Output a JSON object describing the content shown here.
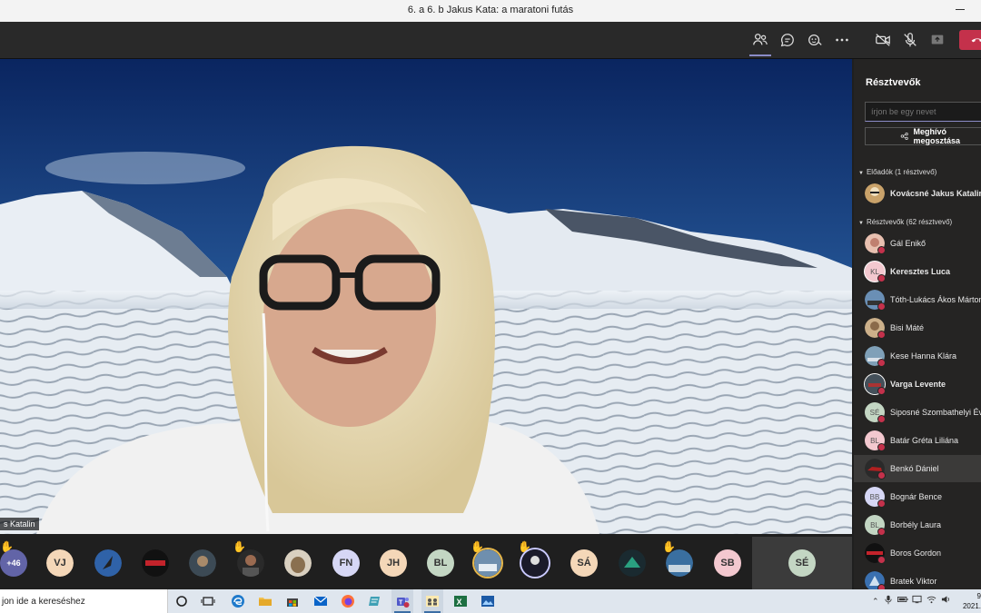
{
  "window": {
    "title": "6. a 6. b Jakus Kata: a maratoni futás"
  },
  "toolbar": {
    "icons": [
      "people-icon",
      "chat-icon",
      "reactions-icon",
      "more-icon",
      "camera-off-icon",
      "mic-off-icon",
      "share-icon",
      "hangup-icon"
    ]
  },
  "stage": {
    "speaker_label": "s Katalin"
  },
  "gallery": {
    "overflow_label": "+46",
    "tiles": [
      {
        "initials": "VJ",
        "color": "#f4d7b8"
      },
      {
        "initials": "FN",
        "color": "#d6d7f5"
      },
      {
        "initials": "JH",
        "color": "#f4d7b8"
      },
      {
        "initials": "BL",
        "color": "#c3d6c3"
      },
      {
        "initials": "SÁ",
        "color": "#f4d7b8"
      },
      {
        "initials": "SB",
        "color": "#f3c8cf"
      }
    ],
    "self_initials": "SÉ"
  },
  "panel": {
    "title": "Résztvevők",
    "search_placeholder": "írjon be egy nevet",
    "invite_label": "Meghívó megosztása",
    "presenters_header": "Előadók (1 résztvevő)",
    "attendees_header": "Résztvevők (62 résztvevő)",
    "presenter": {
      "name": "Kovácsné Jakus Katalin",
      "bold": true
    },
    "attendees": [
      {
        "name": "Gál Enikő",
        "initials": "",
        "bold": false,
        "color": "#d8a0a0"
      },
      {
        "name": "Keresztes Luca",
        "initials": "KL",
        "bold": true,
        "color": "#f3c8cf"
      },
      {
        "name": "Tóth-Lukács Ákos Márton",
        "initials": "",
        "bold": false,
        "color": "#6a8fb5"
      },
      {
        "name": "Bisi Máté",
        "initials": "",
        "bold": false,
        "color": "#8a6a4a"
      },
      {
        "name": "Kese Hanna Klára",
        "initials": "",
        "bold": false,
        "color": "#7fa0b8"
      },
      {
        "name": "Varga Levente",
        "initials": "",
        "bold": true,
        "color": "#44505a"
      },
      {
        "name": "Siposné Szombathelyi Éva",
        "initials": "SÉ",
        "bold": false,
        "color": "#c3d6c3"
      },
      {
        "name": "Batár Gréta Liliána",
        "initials": "BL",
        "bold": false,
        "color": "#f3c8cf"
      },
      {
        "name": "Benkó Dániel",
        "initials": "",
        "bold": false,
        "color": "#8a2020"
      },
      {
        "name": "Bognár Bence",
        "initials": "BB",
        "bold": false,
        "color": "#d6d7f5"
      },
      {
        "name": "Borbély Laura",
        "initials": "BL",
        "bold": false,
        "color": "#c3d6c3"
      },
      {
        "name": "Boros Gordon",
        "initials": "",
        "bold": false,
        "color": "#111111"
      },
      {
        "name": "Bratek Viktor",
        "initials": "",
        "bold": false,
        "color": "#3a70b0"
      }
    ]
  },
  "taskbar": {
    "search_text": "jon ide a kereséshez",
    "clock_time": "9",
    "clock_date": "2021."
  },
  "colors": {
    "accent": "#8b8cc7",
    "hangup": "#c4314b",
    "status_busy": "#c4314b"
  }
}
